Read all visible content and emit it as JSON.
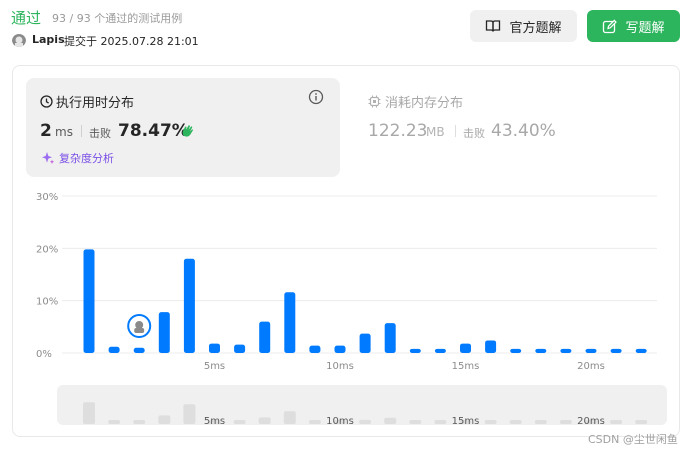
{
  "header": {
    "status": "通过",
    "passed_count": "93 / 93 个通过的测试用例",
    "username": "Lapis",
    "submitted": "提交于 2025.07.28 21:01",
    "official_solution_label": "官方题解",
    "write_solution_label": "写题解"
  },
  "runtime": {
    "title": "执行用时分布",
    "value": "2",
    "unit": "ms",
    "beat_label": "击败",
    "beat_value": "78.47%",
    "complexity_link": "复杂度分析"
  },
  "memory": {
    "title": "消耗内存分布",
    "value": "122.23",
    "unit": "MB",
    "beat_label": "击败",
    "beat_value": "43.40%"
  },
  "colors": {
    "accent": "#2db55d",
    "bar": "#007aff",
    "purple": "#7a4ee6",
    "mini_bar": "#dedede",
    "mini_bg": "#f0f0f0"
  },
  "chart_data": {
    "type": "bar",
    "x_unit": "ms",
    "x": [
      1,
      2,
      3,
      4,
      5,
      6,
      7,
      8,
      9,
      10,
      11,
      12,
      13,
      14,
      15,
      16,
      17,
      18,
      19,
      20,
      21,
      22,
      23
    ],
    "values": [
      19.8,
      1.2,
      1.0,
      7.8,
      18.0,
      1.8,
      1.6,
      6.0,
      11.6,
      1.4,
      1.4,
      3.7,
      5.7,
      0.8,
      0.8,
      1.8,
      2.4,
      0.8,
      0.8,
      0.8,
      0.8,
      0.8,
      0.8
    ],
    "ylim": [
      0,
      30
    ],
    "yticks": [
      "0%",
      "10%",
      "20%",
      "30%"
    ],
    "xticks": [
      {
        "x": 6,
        "label": "5ms"
      },
      {
        "x": 11,
        "label": "10ms"
      },
      {
        "x": 16,
        "label": "15ms"
      },
      {
        "x": 21,
        "label": "20ms"
      }
    ],
    "your_x": 3,
    "grid": true
  },
  "watermark": "CSDN @尘世闲鱼"
}
